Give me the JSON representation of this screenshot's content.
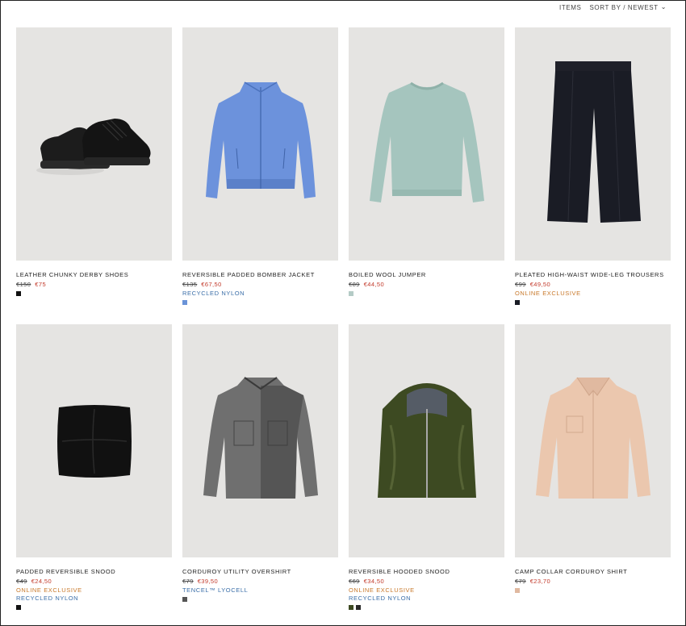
{
  "toolbar": {
    "items": "ITEMS",
    "sort": "SORT BY / NEWEST"
  },
  "products": [
    {
      "title": "LEATHER CHUNKY DERBY SHOES",
      "old_price": "€150",
      "new_price": "€75",
      "tags": [],
      "swatches": [
        "#111111"
      ],
      "image": "shoes-image"
    },
    {
      "title": "REVERSIBLE PADDED BOMBER JACKET",
      "old_price": "€135",
      "new_price": "€67,50",
      "tags": [
        {
          "text": "RECYCLED NYLON",
          "color": "blue"
        }
      ],
      "swatches": [
        "#6a93d8"
      ],
      "image": "jacket-image"
    },
    {
      "title": "BOILED WOOL JUMPER",
      "old_price": "€89",
      "new_price": "€44,50",
      "tags": [],
      "swatches": [
        "#b4cbc6"
      ],
      "image": "jumper-image"
    },
    {
      "title": "PLEATED HIGH-WAIST WIDE-LEG TROUSERS",
      "old_price": "€99",
      "new_price": "€49,50",
      "tags": [
        {
          "text": "ONLINE EXCLUSIVE",
          "color": "orange"
        }
      ],
      "swatches": [
        "#1a1c25"
      ],
      "image": "trousers-image"
    },
    {
      "title": "PADDED REVERSIBLE SNOOD",
      "old_price": "€49",
      "new_price": "€24,50",
      "tags": [
        {
          "text": "ONLINE EXCLUSIVE",
          "color": "orange"
        },
        {
          "text": "RECYCLED NYLON",
          "color": "blue"
        }
      ],
      "swatches": [
        "#111111"
      ],
      "image": "snood-image"
    },
    {
      "title": "CORDUROY UTILITY OVERSHIRT",
      "old_price": "€79",
      "new_price": "€39,50",
      "tags": [
        {
          "text": "TENCEL™ LYOCELL",
          "color": "blue"
        }
      ],
      "swatches": [
        "#555555"
      ],
      "image": "overshirt-image"
    },
    {
      "title": "REVERSIBLE HOODED SNOOD",
      "old_price": "€69",
      "new_price": "€34,50",
      "tags": [
        {
          "text": "ONLINE EXCLUSIVE",
          "color": "orange"
        },
        {
          "text": "RECYCLED NYLON",
          "color": "blue"
        }
      ],
      "swatches": [
        "#3d4a22",
        "#2a2a2a"
      ],
      "image": "hooded-snood-image"
    },
    {
      "title": "CAMP COLLAR CORDUROY SHIRT",
      "old_price": "€79",
      "new_price": "€23,70",
      "tags": [],
      "swatches": [
        "#e0b9a0"
      ],
      "image": "shirt-image"
    }
  ]
}
